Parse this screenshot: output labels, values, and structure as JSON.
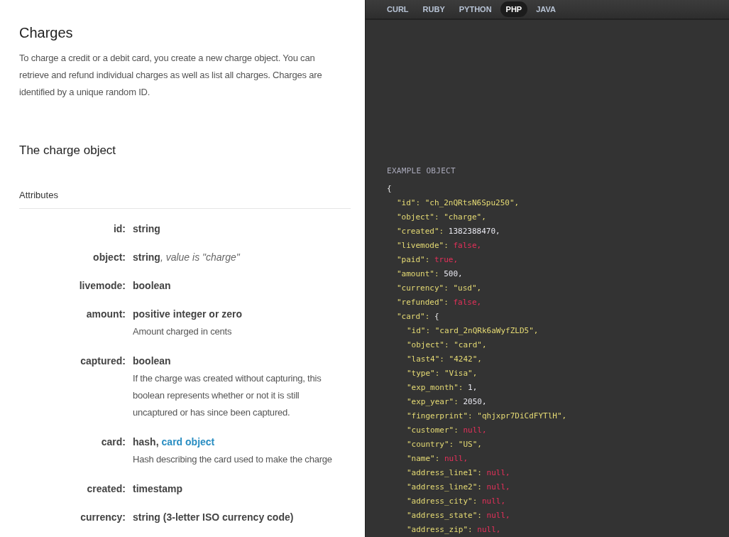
{
  "intro": {
    "title": "Charges",
    "text": "To charge a credit or a debit card, you create a new charge object. You can retrieve and refund individual charges as well as list all charges. Charges are identified by a unique random ID."
  },
  "section": {
    "title": "The charge object",
    "subtitle": "Attributes"
  },
  "attributes": [
    {
      "name": "id:",
      "type": "string"
    },
    {
      "name": "object:",
      "type": "string",
      "note": ", value is \"charge\""
    },
    {
      "name": "livemode:",
      "type": "boolean"
    },
    {
      "name": "amount:",
      "type": "positive integer or zero",
      "description": "Amount charged in cents"
    },
    {
      "name": "captured:",
      "type": "boolean",
      "description": "If the charge was created without capturing, this boolean represents whether or not it is still uncaptured or has since been captured."
    },
    {
      "name": "card:",
      "type": "hash,",
      "link": "card object",
      "description": "Hash describing the card used to make the charge"
    },
    {
      "name": "created:",
      "type": "timestamp"
    },
    {
      "name": "currency:",
      "type": "string (3-letter ISO currency code)"
    }
  ],
  "tabs": [
    {
      "label": "CURL",
      "selected": false
    },
    {
      "label": "RUBY",
      "selected": false
    },
    {
      "label": "PYTHON",
      "selected": false
    },
    {
      "label": "PHP",
      "selected": true
    },
    {
      "label": "JAVA",
      "selected": false
    }
  ],
  "code": {
    "title": "EXAMPLE OBJECT",
    "open": "{",
    "entries": [
      {
        "key": "\"id\":",
        "value": "\"ch_2nQRtsN6Spu250\",",
        "kind": "string"
      },
      {
        "key": "\"object\":",
        "value": "\"charge\",",
        "kind": "string"
      },
      {
        "key": "\"created\":",
        "value": "1382388470,",
        "kind": "number"
      },
      {
        "key": "\"livemode\":",
        "value": "false,",
        "kind": "literal"
      },
      {
        "key": "\"paid\":",
        "value": "true,",
        "kind": "literal"
      },
      {
        "key": "\"amount\":",
        "value": "500,",
        "kind": "number"
      },
      {
        "key": "\"currency\":",
        "value": "\"usd\",",
        "kind": "string"
      },
      {
        "key": "\"refunded\":",
        "value": "false,",
        "kind": "literal"
      },
      {
        "key": "\"card\":",
        "value": "{",
        "kind": "punct",
        "children": [
          {
            "key": "\"id\":",
            "value": "\"card_2nQRk6aWyfZLD5\",",
            "kind": "string"
          },
          {
            "key": "\"object\":",
            "value": "\"card\",",
            "kind": "string"
          },
          {
            "key": "\"last4\":",
            "value": "\"4242\",",
            "kind": "string"
          },
          {
            "key": "\"type\":",
            "value": "\"Visa\",",
            "kind": "string"
          },
          {
            "key": "\"exp_month\":",
            "value": "1,",
            "kind": "number"
          },
          {
            "key": "\"exp_year\":",
            "value": "2050,",
            "kind": "number"
          },
          {
            "key": "\"fingerprint\":",
            "value": "\"qhjxpr7DiCdFYTlH\",",
            "kind": "string"
          },
          {
            "key": "\"customer\":",
            "value": "null,",
            "kind": "literal"
          },
          {
            "key": "\"country\":",
            "value": "\"US\",",
            "kind": "string"
          },
          {
            "key": "\"name\":",
            "value": "null,",
            "kind": "literal"
          },
          {
            "key": "\"address_line1\":",
            "value": "null,",
            "kind": "literal"
          },
          {
            "key": "\"address_line2\":",
            "value": "null,",
            "kind": "literal"
          },
          {
            "key": "\"address_city\":",
            "value": "null,",
            "kind": "literal"
          },
          {
            "key": "\"address_state\":",
            "value": "null,",
            "kind": "literal"
          },
          {
            "key": "\"address_zip\":",
            "value": "null,",
            "kind": "literal"
          }
        ]
      }
    ]
  }
}
